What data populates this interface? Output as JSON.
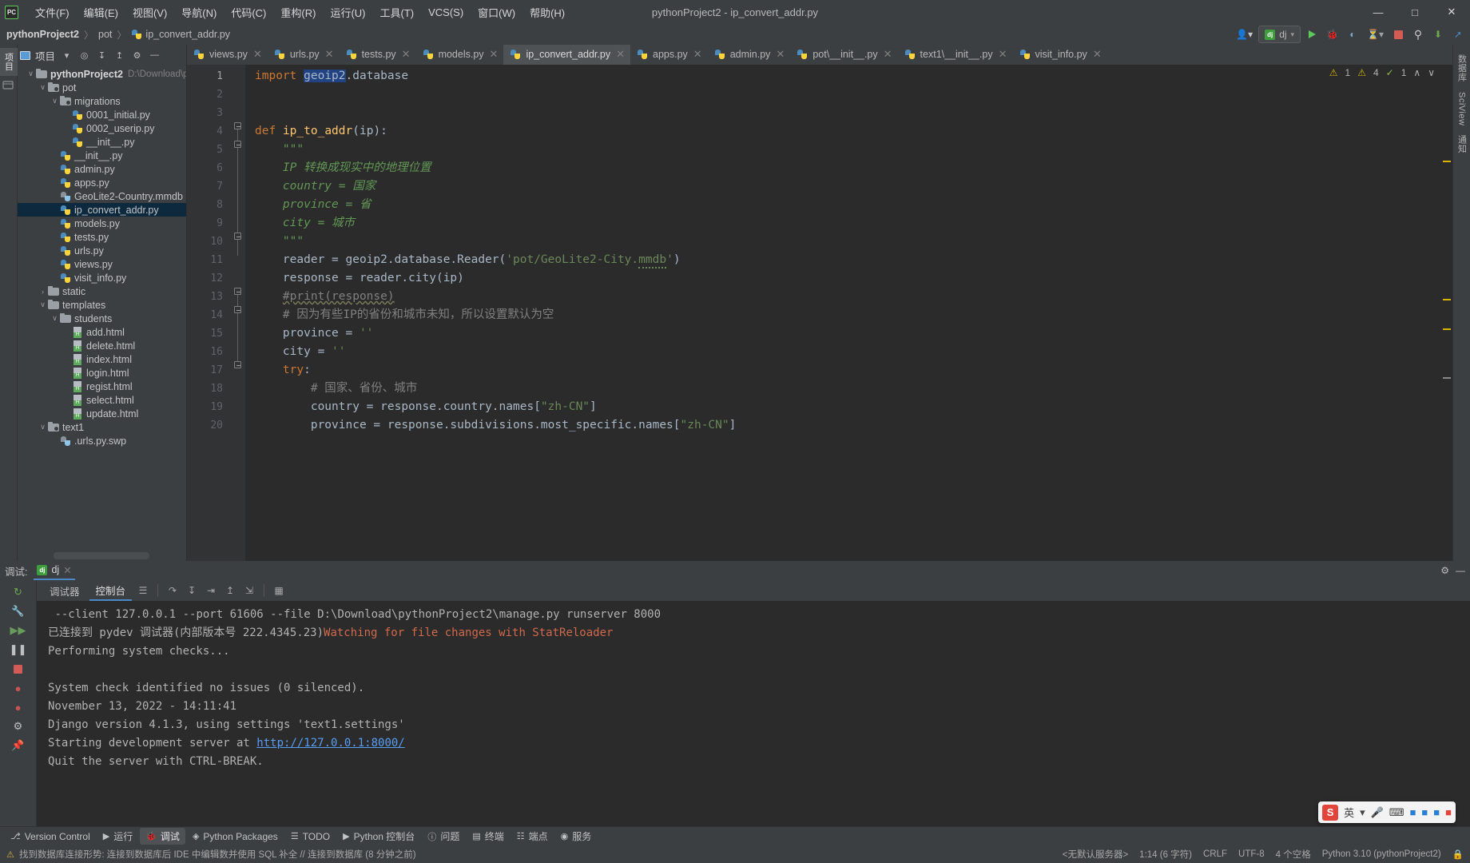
{
  "window": {
    "title": "pythonProject2 - ip_convert_addr.py",
    "logo": "PC",
    "minimize": "—",
    "maximize": "□",
    "close": "✕"
  },
  "menu": {
    "items": [
      "文件(F)",
      "编辑(E)",
      "视图(V)",
      "导航(N)",
      "代码(C)",
      "重构(R)",
      "运行(U)",
      "工具(T)",
      "VCS(S)",
      "窗口(W)",
      "帮助(H)"
    ]
  },
  "breadcrumb": {
    "project": "pythonProject2",
    "sep": "〉",
    "folder": "pot",
    "file": "ip_convert_addr.py"
  },
  "navbar_right": {
    "search_everywhere": "⌕",
    "settings": "⚙",
    "run_config": "dj",
    "run": "▶",
    "debug": "🐞",
    "coverage": "◴",
    "profile": "◳",
    "stop": "■",
    "search": "⚲",
    "update": "⬇",
    "git_push": "↗"
  },
  "left_strip": {
    "tabs": [
      "项目",
      "结构"
    ]
  },
  "right_strip": {
    "tabs": [
      "数据库",
      "SciView",
      "通知"
    ]
  },
  "project_panel": {
    "title": "项目",
    "chevron": "▾",
    "icons": [
      "target-icon",
      "collapse-icon",
      "expand-icon",
      "gear-icon",
      "minimize-icon"
    ],
    "tree": [
      {
        "depth": 0,
        "arrow": "∨",
        "icon": "folder",
        "label": "pythonProject2",
        "bold": true,
        "path": "D:\\Download\\p",
        "selected": false
      },
      {
        "depth": 1,
        "arrow": "∨",
        "icon": "folder-mod",
        "label": "pot",
        "selected": false
      },
      {
        "depth": 2,
        "arrow": "∨",
        "icon": "folder-mod",
        "label": "migrations",
        "selected": false
      },
      {
        "depth": 3,
        "arrow": "",
        "icon": "py",
        "label": "0001_initial.py",
        "selected": false
      },
      {
        "depth": 3,
        "arrow": "",
        "icon": "py",
        "label": "0002_userip.py",
        "selected": false
      },
      {
        "depth": 3,
        "arrow": "",
        "icon": "py",
        "label": "__init__.py",
        "selected": false
      },
      {
        "depth": 2,
        "arrow": "",
        "icon": "py",
        "label": "__init__.py",
        "selected": false
      },
      {
        "depth": 2,
        "arrow": "",
        "icon": "py",
        "label": "admin.py",
        "selected": false
      },
      {
        "depth": 2,
        "arrow": "",
        "icon": "py",
        "label": "apps.py",
        "selected": false
      },
      {
        "depth": 2,
        "arrow": "",
        "icon": "py-q",
        "label": "GeoLite2-Country.mmdb",
        "selected": false
      },
      {
        "depth": 2,
        "arrow": "",
        "icon": "py",
        "label": "ip_convert_addr.py",
        "selected": true
      },
      {
        "depth": 2,
        "arrow": "",
        "icon": "py",
        "label": "models.py",
        "selected": false
      },
      {
        "depth": 2,
        "arrow": "",
        "icon": "py",
        "label": "tests.py",
        "selected": false
      },
      {
        "depth": 2,
        "arrow": "",
        "icon": "py",
        "label": "urls.py",
        "selected": false
      },
      {
        "depth": 2,
        "arrow": "",
        "icon": "py",
        "label": "views.py",
        "selected": false
      },
      {
        "depth": 2,
        "arrow": "",
        "icon": "py",
        "label": "visit_info.py",
        "selected": false
      },
      {
        "depth": 1,
        "arrow": "›",
        "icon": "folder",
        "label": "static",
        "selected": false
      },
      {
        "depth": 1,
        "arrow": "∨",
        "icon": "folder",
        "label": "templates",
        "selected": false
      },
      {
        "depth": 2,
        "arrow": "∨",
        "icon": "folder",
        "label": "students",
        "selected": false
      },
      {
        "depth": 3,
        "arrow": "",
        "icon": "html",
        "label": "add.html",
        "selected": false
      },
      {
        "depth": 3,
        "arrow": "",
        "icon": "html",
        "label": "delete.html",
        "selected": false
      },
      {
        "depth": 3,
        "arrow": "",
        "icon": "html",
        "label": "index.html",
        "selected": false
      },
      {
        "depth": 3,
        "arrow": "",
        "icon": "html",
        "label": "login.html",
        "selected": false
      },
      {
        "depth": 3,
        "arrow": "",
        "icon": "html",
        "label": "regist.html",
        "selected": false
      },
      {
        "depth": 3,
        "arrow": "",
        "icon": "html",
        "label": "select.html",
        "selected": false
      },
      {
        "depth": 3,
        "arrow": "",
        "icon": "html",
        "label": "update.html",
        "selected": false
      },
      {
        "depth": 1,
        "arrow": "∨",
        "icon": "folder-mod",
        "label": "text1",
        "selected": false
      },
      {
        "depth": 2,
        "arrow": "",
        "icon": "py-q",
        "label": ".urls.py.swp",
        "selected": false
      }
    ]
  },
  "editor": {
    "tabs": [
      {
        "label": "views.py",
        "active": false
      },
      {
        "label": "urls.py",
        "active": false
      },
      {
        "label": "tests.py",
        "active": false
      },
      {
        "label": "models.py",
        "active": false
      },
      {
        "label": "ip_convert_addr.py",
        "active": true
      },
      {
        "label": "apps.py",
        "active": false
      },
      {
        "label": "admin.py",
        "active": false
      },
      {
        "label": "pot\\__init__.py",
        "active": false
      },
      {
        "label": "text1\\__init__.py",
        "active": false
      },
      {
        "label": "visit_info.py",
        "active": false
      }
    ],
    "close_glyph": "✕",
    "inspections": {
      "warning_icon": "⚠",
      "warning_count": "1",
      "weak_warning_icon": "⚠",
      "weak_warning_count": "4",
      "typo_icon": "✓",
      "typo_count": "1",
      "up_arrow": "∧",
      "down_arrow": "∨"
    },
    "line_numbers": [
      "1",
      "2",
      "3",
      "4",
      "5",
      "6",
      "7",
      "8",
      "9",
      "10",
      "11",
      "12",
      "13",
      "14",
      "15",
      "16",
      "17",
      "18",
      "19",
      "20"
    ],
    "lines": [
      {
        "n": 1,
        "text": "import geoip2.database"
      },
      {
        "n": 2,
        "text": ""
      },
      {
        "n": 3,
        "text": ""
      },
      {
        "n": 4,
        "text": "def ip_to_addr(ip):"
      },
      {
        "n": 5,
        "text": "    \"\"\""
      },
      {
        "n": 6,
        "text": "    IP 转换成现实中的地理位置"
      },
      {
        "n": 7,
        "text": "    country = 国家"
      },
      {
        "n": 8,
        "text": "    province = 省"
      },
      {
        "n": 9,
        "text": "    city = 城市"
      },
      {
        "n": 10,
        "text": "    \"\"\""
      },
      {
        "n": 11,
        "text": "    reader = geoip2.database.Reader('pot/GeoLite2-City.mmdb')"
      },
      {
        "n": 12,
        "text": "    response = reader.city(ip)"
      },
      {
        "n": 13,
        "text": "    #print(response)"
      },
      {
        "n": 14,
        "text": "    # 因为有些IP的省份和城市未知，所以设置默认为空"
      },
      {
        "n": 15,
        "text": "    province = ''"
      },
      {
        "n": 16,
        "text": "    city = ''"
      },
      {
        "n": 17,
        "text": "    try:"
      },
      {
        "n": 18,
        "text": "        # 国家、省份、城市"
      },
      {
        "n": 19,
        "text": "        country = response.country.names[\"zh-CN\"]"
      },
      {
        "n": 20,
        "text": "        province = response.subdivisions.most_specific.names[\"zh-CN\"]"
      }
    ],
    "selected_token": "geoip2"
  },
  "debug": {
    "label": "调试:",
    "tab_name": "dj",
    "tab_close": "✕",
    "gear": "⚙",
    "minimize": "—",
    "subtabs": [
      {
        "label": "调试器",
        "selected": false
      },
      {
        "label": "控制台",
        "selected": true
      }
    ],
    "toolbar_icons": [
      "rerun-icon",
      "up-arrow-icon",
      "resume-icon",
      "pause-icon",
      "stop-icon",
      "breakpoint-icon",
      "mute-breakpoints-icon",
      "settings-icon",
      "pin-icon"
    ],
    "step_icons": [
      "show-tools-icon",
      "step-over-icon",
      "step-into-icon",
      "force-step-into-icon",
      "step-out-icon",
      "run-to-cursor-icon",
      "evaluate-icon"
    ],
    "console_lines": [
      {
        "segments": [
          {
            "t": " --client 127.0.0.1 --port 61606 --file D:\\Download\\pythonProject2\\manage.py runserver 8000",
            "c": "plain"
          }
        ]
      },
      {
        "segments": [
          {
            "t": "已连接到 pydev 调试器(内部版本号 222.4345.23)",
            "c": "plain"
          },
          {
            "t": "Watching for file changes with StatReloader",
            "c": "red"
          }
        ]
      },
      {
        "segments": [
          {
            "t": "Performing system checks...",
            "c": "plain"
          }
        ]
      },
      {
        "segments": [
          {
            "t": "",
            "c": "plain"
          }
        ]
      },
      {
        "segments": [
          {
            "t": "System check identified no issues (0 silenced).",
            "c": "plain"
          }
        ]
      },
      {
        "segments": [
          {
            "t": "November 13, 2022 - 14:11:41",
            "c": "plain"
          }
        ]
      },
      {
        "segments": [
          {
            "t": "Django version 4.1.3, using settings 'text1.settings'",
            "c": "plain"
          }
        ]
      },
      {
        "segments": [
          {
            "t": "Starting development server at ",
            "c": "plain"
          },
          {
            "t": "http://127.0.0.1:8000/",
            "c": "link"
          }
        ]
      },
      {
        "segments": [
          {
            "t": "Quit the server with CTRL-BREAK.",
            "c": "plain"
          }
        ]
      }
    ]
  },
  "ime": {
    "logo": "S",
    "mode": "英",
    "items": [
      "▾",
      "🎤",
      "⌨",
      "⬛",
      "⬛",
      "⚙",
      "⬛"
    ]
  },
  "bottom_bar": {
    "items": [
      {
        "icon": "⎇",
        "label": "Version Control",
        "selected": false
      },
      {
        "icon": "▶",
        "label": "运行",
        "selected": false
      },
      {
        "icon": "🐞",
        "label": "调试",
        "selected": true
      },
      {
        "icon": "◈",
        "label": "Python Packages",
        "selected": false
      },
      {
        "icon": "☰",
        "label": "TODO",
        "selected": false
      },
      {
        "icon": "▶",
        "label": "Python 控制台",
        "selected": false
      },
      {
        "icon": "ⓘ",
        "label": "问题",
        "selected": false
      },
      {
        "icon": "▤",
        "label": "终端",
        "selected": false
      },
      {
        "icon": "☷",
        "label": "端点",
        "selected": false
      },
      {
        "icon": "◉",
        "label": "服务",
        "selected": false
      }
    ]
  },
  "status_bar": {
    "warn_icon": "⚠",
    "message": "找到数据库连接形势: 连接到数据库后 IDE 中编辑数并使用 SQL 补全 // 连接到数据库 (8 分钟之前)",
    "server": "<无默认服务器>",
    "caret": "1:14 (6 字符)",
    "line_sep": "CRLF",
    "encoding": "UTF-8",
    "indent": "4 个空格",
    "interpreter": "Python 3.10 (pythonProject2)",
    "lock": "🔒"
  }
}
